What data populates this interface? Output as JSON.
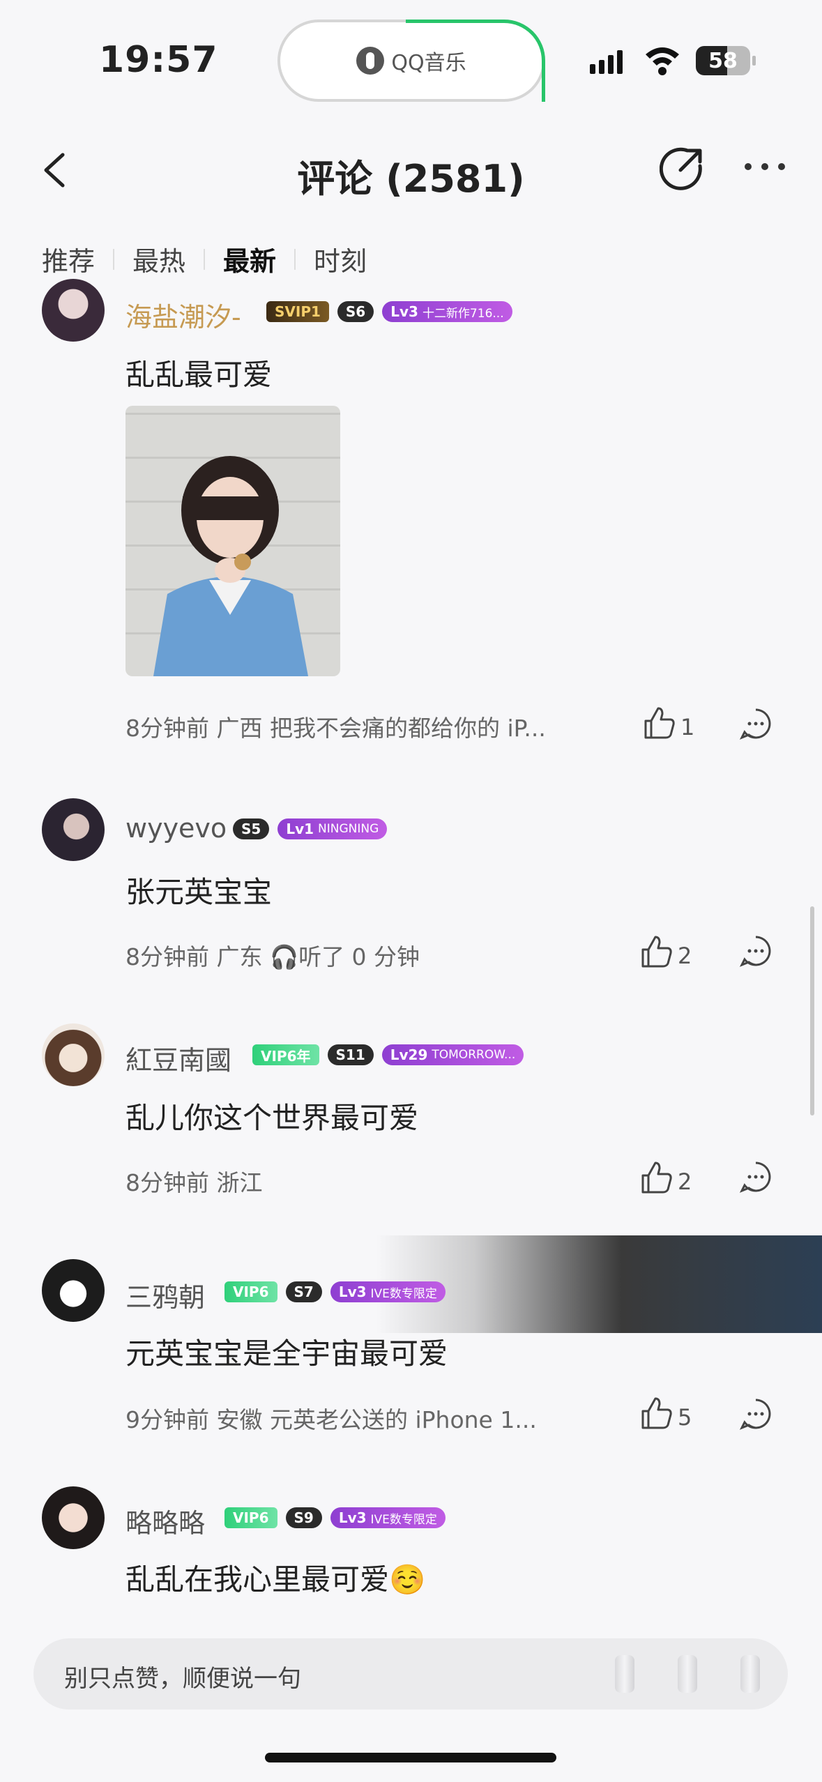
{
  "status_bar": {
    "time": "19:57",
    "app_island": "QQ音乐",
    "battery": "58"
  },
  "nav": {
    "title": "评论 (2581)"
  },
  "tabs": [
    {
      "label": "推荐",
      "active": false
    },
    {
      "label": "最热",
      "active": false
    },
    {
      "label": "最新",
      "active": true
    },
    {
      "label": "时刻",
      "active": false
    }
  ],
  "comments": [
    {
      "username": "海盐潮汐-",
      "vip_badge": "SVIP1",
      "s_badge": "S6",
      "lv_badge": "Lv3",
      "lv_note": "十二新作716...",
      "text": "乱乱最可爱",
      "meta": "8分钟前  广西  把我不会痛的都给你的 iP...",
      "likes": "1"
    },
    {
      "username": "wyyevo",
      "s_badge": "S5",
      "lv_badge": "Lv1",
      "lv_note": "NINGNING",
      "text": "张元英宝宝",
      "meta": "8分钟前  广东  🎧听了 0 分钟",
      "likes": "2"
    },
    {
      "username": "紅豆南國",
      "vip_badge": "VIP6年",
      "s_badge": "S11",
      "lv_badge": "Lv29",
      "lv_note": "TOMORROW...",
      "text": "乱儿你这个世界最可爱",
      "meta": "8分钟前  浙江",
      "likes": "2"
    },
    {
      "username": "三鸦朝",
      "vip_badge": "VIP6",
      "s_badge": "S7",
      "lv_badge": "Lv3",
      "lv_note": "IVE数专限定",
      "text": "元英宝宝是全宇宙最可爱",
      "meta": "9分钟前  安徽  元英老公送的 iPhone 1...",
      "likes": "5"
    },
    {
      "username": "略略略",
      "vip_badge": "VIP6",
      "s_badge": "S9",
      "lv_badge": "Lv3",
      "lv_note": "IVE数专限定",
      "text": "乱乱在我心里最可爱☺️"
    }
  ],
  "input": {
    "placeholder": "别只点赞，顺便说一句"
  },
  "colors": {
    "accent_green": "#28c56a",
    "gold_name": "#c69a52",
    "lv_purple": "#a94cd9"
  }
}
